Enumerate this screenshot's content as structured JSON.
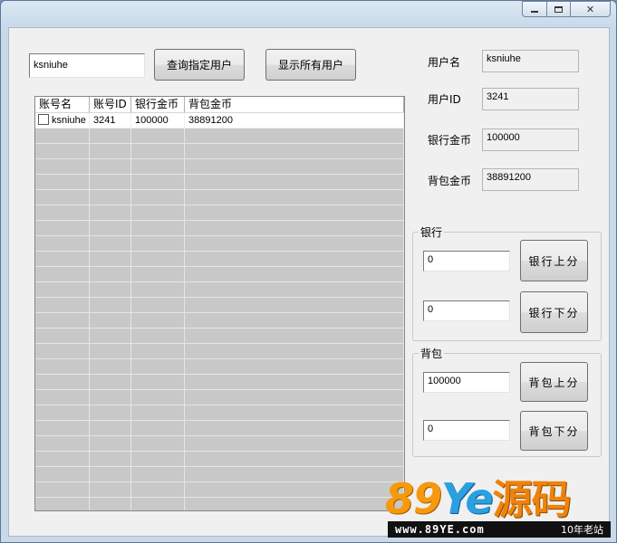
{
  "titlebar": {
    "minimize": "",
    "maximize": "",
    "close": "✕"
  },
  "query": {
    "input_value": "ksniuhe",
    "query_button": "查询指定用户",
    "show_all_button": "显示所有用户"
  },
  "grid": {
    "columns": [
      "账号名",
      "账号ID",
      "银行金币",
      "背包金币"
    ],
    "rows": [
      {
        "account": "ksniuhe",
        "id": "3241",
        "bank": "100000",
        "bag": "38891200"
      }
    ]
  },
  "details": {
    "username_label": "用户名",
    "username_value": "ksniuhe",
    "userid_label": "用户ID",
    "userid_value": "3241",
    "bank_label": "银行金币",
    "bank_value": "100000",
    "bag_label": "背包金币",
    "bag_value": "38891200"
  },
  "bank_group": {
    "title": "银行",
    "up_value": "0",
    "up_button": "银行上分",
    "down_value": "0",
    "down_button": "银行下分"
  },
  "bag_group": {
    "title": "背包",
    "up_value": "100000",
    "up_button": "背包上分",
    "down_value": "0",
    "down_button": "背包下分"
  },
  "watermark": {
    "brand_num": "89",
    "brand_ye": "Ye",
    "brand_cn": "源码",
    "url": "www.89YE.com",
    "tagline": "10年老站"
  }
}
